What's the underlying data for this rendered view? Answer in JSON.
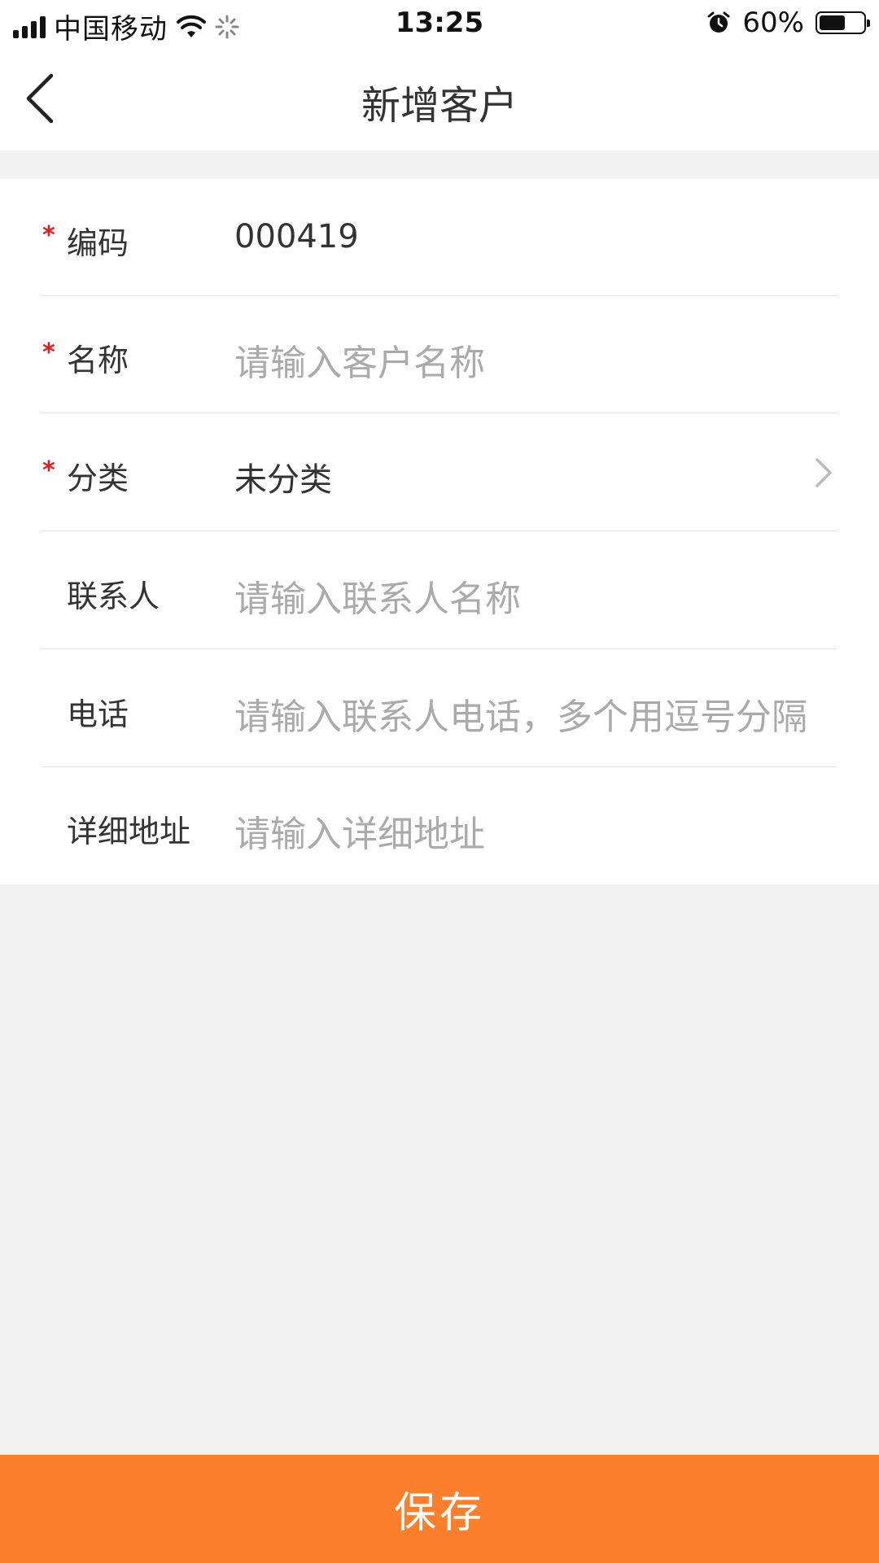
{
  "status_bar": {
    "carrier": "中国移动",
    "time": "13:25",
    "battery_text": "60%",
    "battery_level": 0.6,
    "icons": [
      "signal-icon",
      "wifi-icon",
      "loading-icon",
      "alarm-icon",
      "battery-icon"
    ]
  },
  "nav": {
    "title": "新增客户",
    "back_icon": "chevron-left-icon"
  },
  "form": {
    "code": {
      "required_mark": "*",
      "label": "编码",
      "value": "000419"
    },
    "name": {
      "required_mark": "*",
      "label": "名称",
      "placeholder": "请输入客户名称"
    },
    "category": {
      "required_mark": "*",
      "label": "分类",
      "value": "未分类",
      "icon": "chevron-right-icon"
    },
    "contact": {
      "label": "联系人",
      "placeholder": "请输入联系人名称"
    },
    "phone": {
      "label": "电话",
      "placeholder": "请输入联系人电话，多个用逗号分隔"
    },
    "address": {
      "label": "详细地址",
      "placeholder": "请输入详细地址"
    }
  },
  "footer": {
    "save_label": "保存"
  },
  "colors": {
    "accent": "#fd7e2b",
    "required": "#e02020",
    "placeholder": "#aaaaaa",
    "background": "#f2f2f2"
  }
}
